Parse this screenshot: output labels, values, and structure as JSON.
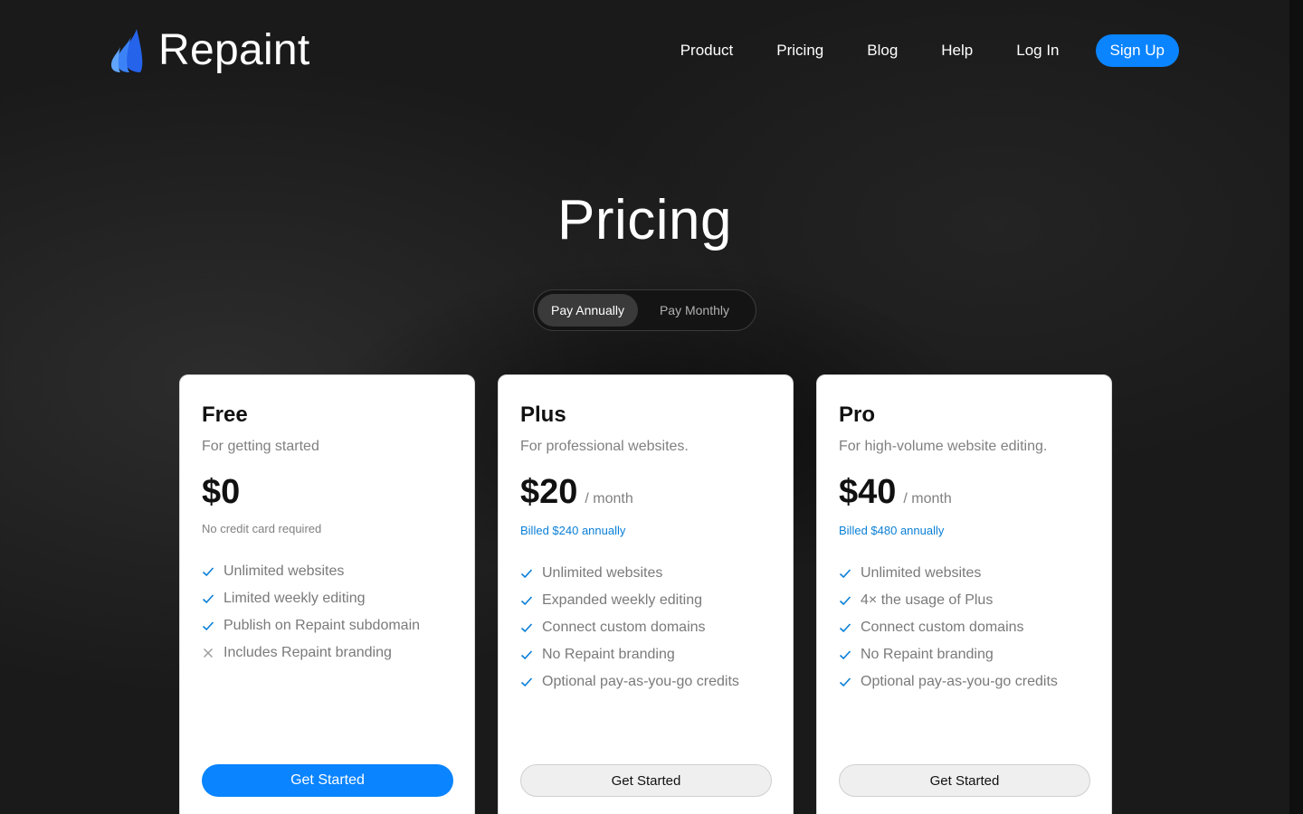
{
  "brand": {
    "name": "Repaint",
    "icon": "drop-logo-icon",
    "accent": "#0a84ff"
  },
  "nav": {
    "items": [
      {
        "label": "Product"
      },
      {
        "label": "Pricing"
      },
      {
        "label": "Blog"
      },
      {
        "label": "Help"
      }
    ],
    "login_label": "Log In",
    "signup_label": "Sign Up"
  },
  "page": {
    "title": "Pricing"
  },
  "billing_toggle": {
    "options": [
      {
        "label": "Pay Annually",
        "selected": true
      },
      {
        "label": "Pay Monthly",
        "selected": false
      }
    ]
  },
  "plans": [
    {
      "name": "Free",
      "description": "For getting started",
      "price": "$0",
      "period": "",
      "billing_note": "No credit card required",
      "features": [
        {
          "text": "Unlimited websites",
          "icon": "check-icon"
        },
        {
          "text": "Limited weekly editing",
          "icon": "check-icon"
        },
        {
          "text": "Publish on Repaint subdomain",
          "icon": "check-icon"
        },
        {
          "text": "Includes Repaint branding",
          "icon": "x-icon"
        }
      ],
      "cta_label": "Get Started"
    },
    {
      "name": "Plus",
      "description": "For professional websites.",
      "price": "$20",
      "period": "/ month",
      "billing_note": "Billed $240 annually",
      "features": [
        {
          "text": "Unlimited websites",
          "icon": "check-icon"
        },
        {
          "text": "Expanded weekly editing",
          "icon": "check-icon"
        },
        {
          "text": "Connect custom domains",
          "icon": "check-icon"
        },
        {
          "text": "No Repaint branding",
          "icon": "check-icon"
        },
        {
          "text": "Optional pay-as-you-go credits",
          "icon": "check-icon"
        }
      ],
      "cta_label": "Get Started"
    },
    {
      "name": "Pro",
      "description": "For high-volume website editing.",
      "price": "$40",
      "period": "/ month",
      "billing_note": "Billed $480 annually",
      "features": [
        {
          "text": "Unlimited websites",
          "icon": "check-icon"
        },
        {
          "text": "4× the usage of Plus",
          "icon": "check-icon"
        },
        {
          "text": "Connect custom domains",
          "icon": "check-icon"
        },
        {
          "text": "No Repaint branding",
          "icon": "check-icon"
        },
        {
          "text": "Optional pay-as-you-go credits",
          "icon": "check-icon"
        }
      ],
      "cta_label": "Get Started"
    }
  ]
}
